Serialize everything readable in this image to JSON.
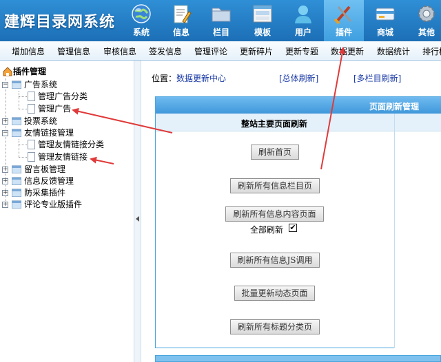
{
  "header": {
    "brand": "建辉目录网系统",
    "nav": [
      {
        "label": "系统",
        "icon": "globe-icon"
      },
      {
        "label": "信息",
        "icon": "document-pencil-icon"
      },
      {
        "label": "栏目",
        "icon": "folder-icon"
      },
      {
        "label": "模板",
        "icon": "window-icon"
      },
      {
        "label": "用户",
        "icon": "user-icon"
      },
      {
        "label": "插件",
        "icon": "tools-icon",
        "active": true
      },
      {
        "label": "商城",
        "icon": "card-icon"
      },
      {
        "label": "其他",
        "icon": "gear-icon"
      }
    ]
  },
  "subnav": [
    "增加信息",
    "管理信息",
    "审核信息",
    "签发信息",
    "管理评论",
    "更新碎片",
    "更新专题",
    "数据更新",
    "数据统计",
    "排行榜"
  ],
  "tree": {
    "root": "插件管理",
    "nodes": [
      {
        "label": "广告系统",
        "children": [
          "管理广告分类",
          "管理广告"
        ]
      },
      {
        "label": "投票系统"
      },
      {
        "label": "友情链接管理",
        "children": [
          "管理友情链接分类",
          "管理友情链接"
        ]
      },
      {
        "label": "留言板管理"
      },
      {
        "label": "信息反馈管理"
      },
      {
        "label": "防采集插件"
      },
      {
        "label": "评论专业版插件"
      }
    ]
  },
  "main": {
    "location_prefix": "位置：",
    "location_link": "数据更新中心",
    "refresh_all": "[总体刷新]",
    "refresh_multi": "[多栏目刷新]",
    "panel_title": "页面刷新管理",
    "section_title": "整站主要页面刷新",
    "buttons": {
      "home": "刷新首页",
      "class_index": "刷新所有信息栏目页",
      "content": "刷新所有信息内容页面",
      "js": "刷新所有信息JS调用",
      "dynamic": "批量更新动态页面",
      "title_class": "刷新所有标题分类页"
    },
    "full_refresh_label": "全部刷新",
    "full_refresh_checked": true,
    "check_mark": "✔"
  },
  "colors": {
    "accent": "#2f8fd6",
    "arrow": "#e03a3a",
    "link": "#1a3aa6"
  }
}
